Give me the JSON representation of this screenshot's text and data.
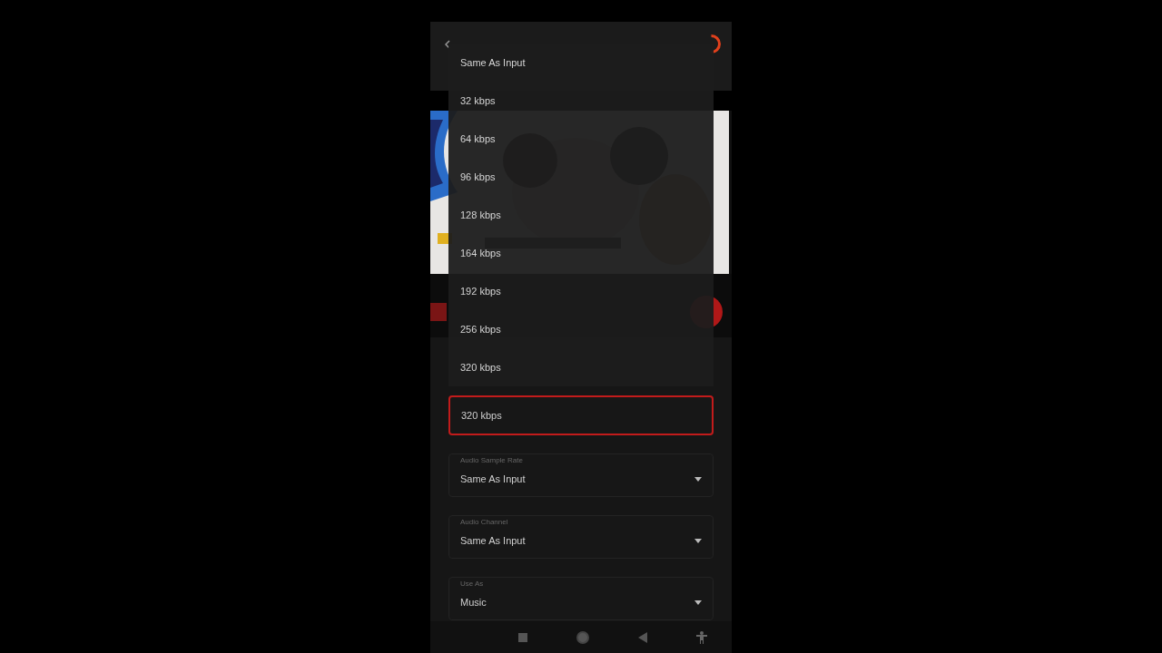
{
  "menu": {
    "options": [
      "Same As Input",
      "32 kbps",
      "64 kbps",
      "96 kbps",
      "128 kbps",
      "164 kbps",
      "192 kbps",
      "256 kbps",
      "320 kbps"
    ]
  },
  "fields": [
    {
      "kind": "text",
      "value": "320 kbps",
      "focused": true
    },
    {
      "kind": "dropdown",
      "label": "Audio Sample Rate",
      "value": "Same As Input",
      "focused": false
    },
    {
      "kind": "dropdown",
      "label": "Audio Channel",
      "value": "Same As Input",
      "focused": false
    },
    {
      "kind": "dropdown",
      "label": "Use As",
      "value": "Music",
      "focused": false
    }
  ]
}
